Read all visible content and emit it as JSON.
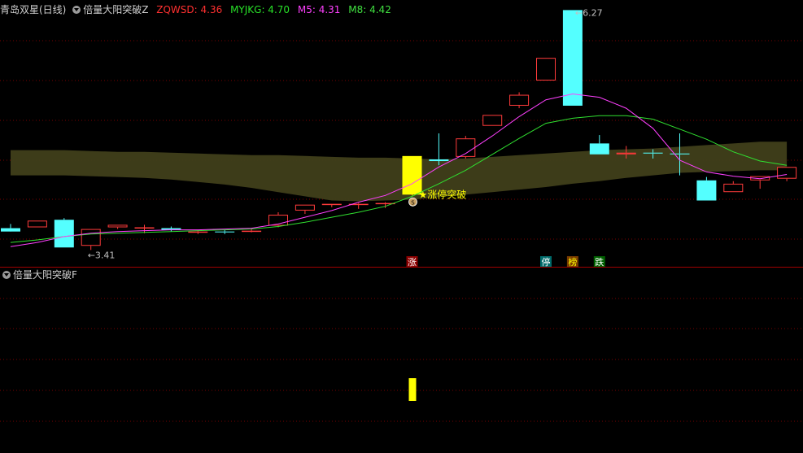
{
  "header": {
    "main_title": "青岛双星(日线)",
    "indicator_name": "倍量大阳突破Z",
    "values": [
      {
        "label": "ZQWSD: 4.36",
        "color": "#ff3030"
      },
      {
        "label": "MYJKG: 4.70",
        "color": "#28e028"
      },
      {
        "label": "M5: 4.31",
        "color": "#ff40ff"
      },
      {
        "label": "M8: 4.42",
        "color": "#40e040"
      }
    ]
  },
  "sub_header": {
    "indicator_name": "倍量大阳突破F"
  },
  "colors": {
    "up": "#ff3b3b",
    "down": "#54ffff",
    "signal": "#ffff00",
    "m5": "#ff40ff",
    "m8": "#30e030",
    "band": "#403f1a",
    "grid": "#7a0000",
    "divider": "#a00000",
    "text": "#c0c0c0"
  },
  "chart_data": {
    "type": "candlestick",
    "price_range": [
      3.21,
      6.39
    ],
    "candles": [
      {
        "o": 3.67,
        "h": 3.72,
        "l": 3.64,
        "c": 3.63
      },
      {
        "o": 3.68,
        "h": 3.76,
        "l": 3.68,
        "c": 3.76
      },
      {
        "o": 3.77,
        "h": 3.79,
        "l": 3.44,
        "c": 3.44
      },
      {
        "o": 3.46,
        "h": 3.66,
        "l": 3.41,
        "c": 3.66
      },
      {
        "o": 3.68,
        "h": 3.71,
        "l": 3.66,
        "c": 3.71
      },
      {
        "o": 3.68,
        "h": 3.71,
        "l": 3.61,
        "c": 3.68
      },
      {
        "o": 3.67,
        "h": 3.69,
        "l": 3.63,
        "c": 3.65
      },
      {
        "o": 3.63,
        "h": 3.65,
        "l": 3.6,
        "c": 3.63
      },
      {
        "o": 3.63,
        "h": 3.65,
        "l": 3.6,
        "c": 3.62
      },
      {
        "o": 3.64,
        "h": 3.67,
        "l": 3.62,
        "c": 3.64
      },
      {
        "o": 3.7,
        "h": 3.86,
        "l": 3.68,
        "c": 3.83
      },
      {
        "o": 3.88,
        "h": 3.95,
        "l": 3.84,
        "c": 3.95
      },
      {
        "o": 3.95,
        "h": 3.96,
        "l": 3.92,
        "c": 3.96
      },
      {
        "o": 3.95,
        "h": 3.97,
        "l": 3.9,
        "c": 3.96
      },
      {
        "o": 3.96,
        "h": 3.98,
        "l": 3.91,
        "c": 3.97
      },
      {
        "o": 4.07,
        "h": 4.53,
        "l": 4.06,
        "c": 4.53
      },
      {
        "o": 4.49,
        "h": 4.8,
        "l": 4.42,
        "c": 4.47
      },
      {
        "o": 4.52,
        "h": 4.77,
        "l": 4.5,
        "c": 4.74
      },
      {
        "o": 4.89,
        "h": 5.02,
        "l": 4.89,
        "c": 5.02
      },
      {
        "o": 5.13,
        "h": 5.29,
        "l": 5.1,
        "c": 5.26
      },
      {
        "o": 5.43,
        "h": 5.7,
        "l": 5.43,
        "c": 5.7
      },
      {
        "o": 6.27,
        "h": 6.27,
        "l": 5.13,
        "c": 5.13
      },
      {
        "o": 4.68,
        "h": 4.78,
        "l": 4.55,
        "c": 4.55
      },
      {
        "o": 4.55,
        "h": 4.65,
        "l": 4.5,
        "c": 4.57
      },
      {
        "o": 4.57,
        "h": 4.61,
        "l": 4.5,
        "c": 4.56
      },
      {
        "o": 4.56,
        "h": 4.8,
        "l": 4.3,
        "c": 4.55
      },
      {
        "o": 4.24,
        "h": 4.28,
        "l": 4.0,
        "c": 4.0
      },
      {
        "o": 4.1,
        "h": 4.23,
        "l": 4.1,
        "c": 4.2
      },
      {
        "o": 4.24,
        "h": 4.28,
        "l": 4.14,
        "c": 4.29
      },
      {
        "o": 4.26,
        "h": 4.4,
        "l": 4.23,
        "c": 4.4
      }
    ],
    "m5": [
      3.45,
      3.5,
      3.57,
      3.61,
      3.63,
      3.64,
      3.65,
      3.65,
      3.66,
      3.67,
      3.72,
      3.8,
      3.88,
      3.98,
      4.06,
      4.2,
      4.4,
      4.56,
      4.77,
      5.0,
      5.2,
      5.27,
      5.23,
      5.1,
      4.86,
      4.48,
      4.34,
      4.29,
      4.26,
      4.31
    ],
    "m8": [
      3.5,
      3.53,
      3.57,
      3.6,
      3.61,
      3.62,
      3.63,
      3.64,
      3.65,
      3.66,
      3.69,
      3.74,
      3.8,
      3.86,
      3.93,
      4.05,
      4.2,
      4.36,
      4.55,
      4.74,
      4.92,
      4.98,
      5.01,
      5.01,
      4.97,
      4.85,
      4.73,
      4.58,
      4.47,
      4.42
    ],
    "band_upper": [
      4.6,
      4.6,
      4.6,
      4.59,
      4.58,
      4.58,
      4.57,
      4.56,
      4.55,
      4.54,
      4.54,
      4.53,
      4.52,
      4.51,
      4.51,
      4.5,
      4.49,
      4.5,
      4.52,
      4.54,
      4.56,
      4.58,
      4.6,
      4.61,
      4.62,
      4.64,
      4.66,
      4.68,
      4.7,
      4.7
    ],
    "band_lower": [
      4.3,
      4.3,
      4.3,
      4.29,
      4.28,
      4.27,
      4.25,
      4.22,
      4.19,
      4.15,
      4.1,
      4.05,
      4.0,
      3.99,
      4.0,
      4.01,
      4.04,
      4.07,
      4.1,
      4.13,
      4.16,
      4.2,
      4.23,
      4.27,
      4.3,
      4.33,
      4.34,
      4.35,
      4.36,
      4.36
    ],
    "high_label": "6.27",
    "low_label": "3.41",
    "signal_index": 15,
    "signal_text": "★涨停突破",
    "signal_badge": "S",
    "bottom_markers": [
      {
        "index": 15,
        "label": "涨",
        "bg": "#8b0000",
        "fg": "#ffffff"
      },
      {
        "index": 20,
        "label": "停",
        "bg": "#006b6b",
        "fg": "#ffffff"
      },
      {
        "index": 21,
        "label": "榜",
        "bg": "#7a3c00",
        "fg": "#ffff00"
      },
      {
        "index": 22,
        "label": "跌",
        "bg": "#006000",
        "fg": "#ffffff"
      }
    ],
    "sub_signal_index": 15
  }
}
